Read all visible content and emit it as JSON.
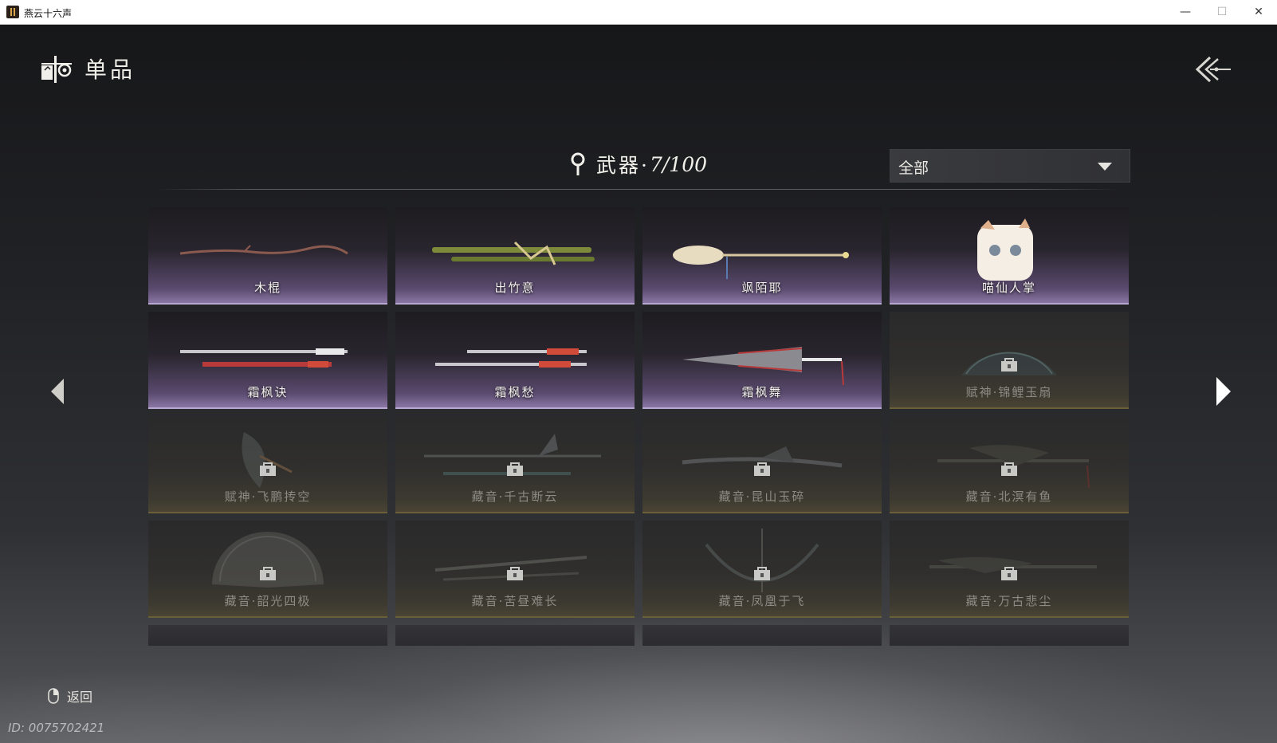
{
  "window": {
    "title": "燕云十六声",
    "minimize": "—",
    "maximize": "☐",
    "close": "✕"
  },
  "header": {
    "title": "单品",
    "icon": "collection-icon",
    "back_icon": "double-back-arrow-icon"
  },
  "section": {
    "title": "武器·",
    "count": "7/100",
    "icon": "location-pin-icon"
  },
  "filter": {
    "value": "全部"
  },
  "items": [
    {
      "label": "木棍",
      "locked": false,
      "art": "stick"
    },
    {
      "label": "出竹意",
      "locked": false,
      "art": "bamboo"
    },
    {
      "label": "飒陌耶",
      "locked": false,
      "art": "spoon"
    },
    {
      "label": "喵仙人掌",
      "locked": false,
      "art": "cat"
    },
    {
      "label": "霜枫诀",
      "locked": false,
      "art": "blades"
    },
    {
      "label": "霜枫愁",
      "locked": false,
      "art": "blades2"
    },
    {
      "label": "霜枫舞",
      "locked": false,
      "art": "umbrella"
    },
    {
      "label": "赋神·锦鲤玉扇",
      "locked": true,
      "art": "fan"
    },
    {
      "label": "赋神·飞鹏抟空",
      "locked": true,
      "art": "bird"
    },
    {
      "label": "藏音·千古断云",
      "locked": true,
      "art": "spear"
    },
    {
      "label": "藏音·昆山玉碎",
      "locked": true,
      "art": "sword"
    },
    {
      "label": "藏音·北溟有鱼",
      "locked": true,
      "art": "spear2"
    },
    {
      "label": "藏音·韶光四极",
      "locked": true,
      "art": "fan2"
    },
    {
      "label": "藏音·苦昼难长",
      "locked": true,
      "art": "blades3"
    },
    {
      "label": "藏音·凤凰于飞",
      "locked": true,
      "art": "bow"
    },
    {
      "label": "藏音·万古悲尘",
      "locked": true,
      "art": "spear3"
    }
  ],
  "footer": {
    "return_label": "返回",
    "return_icon": "mouse-icon",
    "id_text": "ID: 0075702421"
  },
  "colors": {
    "unlocked_glow": "#8a76a4",
    "locked_edge": "#6b5f3a"
  }
}
